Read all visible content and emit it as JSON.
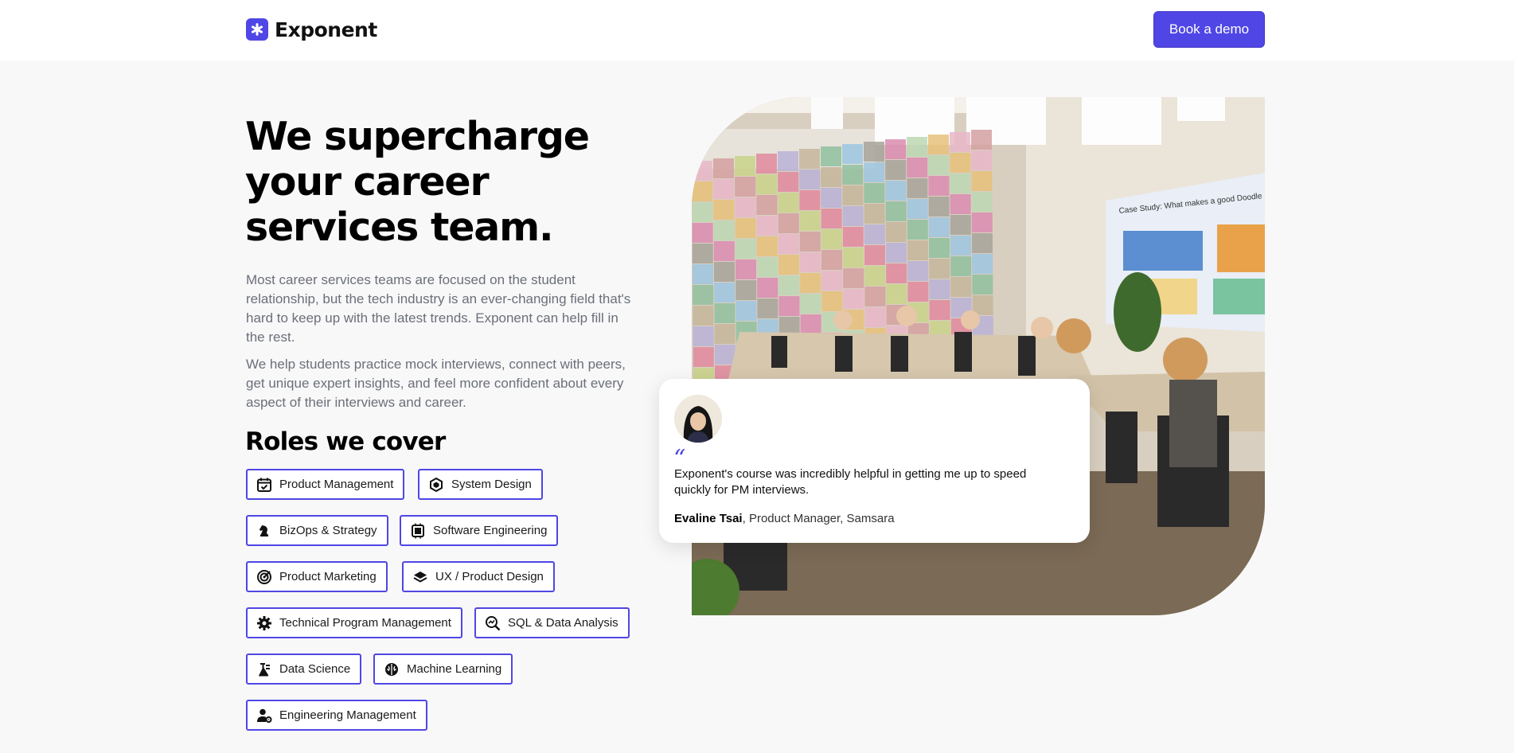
{
  "brand": {
    "name": "Exponent",
    "accent": "#4f46e5"
  },
  "header": {
    "cta_label": "Book a demo"
  },
  "hero": {
    "title": "We supercharge your career services team.",
    "paragraph_1": "Most career services teams are focused on the student relationship, but the tech industry is an ever-changing field that's hard to keep up with the latest trends. Exponent can help fill in the rest.",
    "paragraph_2": "We help students practice mock interviews, connect with peers, get unique expert insights, and feel more confident about every aspect of their interviews and career."
  },
  "roles": {
    "title": "Roles we cover",
    "items": [
      {
        "label": "Product Management",
        "icon": "calendar-check-icon"
      },
      {
        "label": "System Design",
        "icon": "hexagon-icon"
      },
      {
        "label": "BizOps & Strategy",
        "icon": "chess-knight-icon"
      },
      {
        "label": "Software Engineering",
        "icon": "code-chip-icon"
      },
      {
        "label": "Product Marketing",
        "icon": "target-icon"
      },
      {
        "label": "UX / Product Design",
        "icon": "layers-icon"
      },
      {
        "label": "Technical Program Management",
        "icon": "gear-icon"
      },
      {
        "label": "SQL & Data Analysis",
        "icon": "magnify-chart-icon"
      },
      {
        "label": "Data Science",
        "icon": "flask-icon"
      },
      {
        "label": "Machine Learning",
        "icon": "brain-icon"
      },
      {
        "label": "Engineering Management",
        "icon": "user-gear-icon"
      }
    ]
  },
  "photo": {
    "screen_text": "Case Study: What makes a good Doodle"
  },
  "testimonial": {
    "quote_mark": "“",
    "quote": "Exponent's course was incredibly helpful in getting me up to speed quickly for PM interviews.",
    "author_name": "Evaline Tsai",
    "author_role": ", Product Manager, Samsara"
  }
}
